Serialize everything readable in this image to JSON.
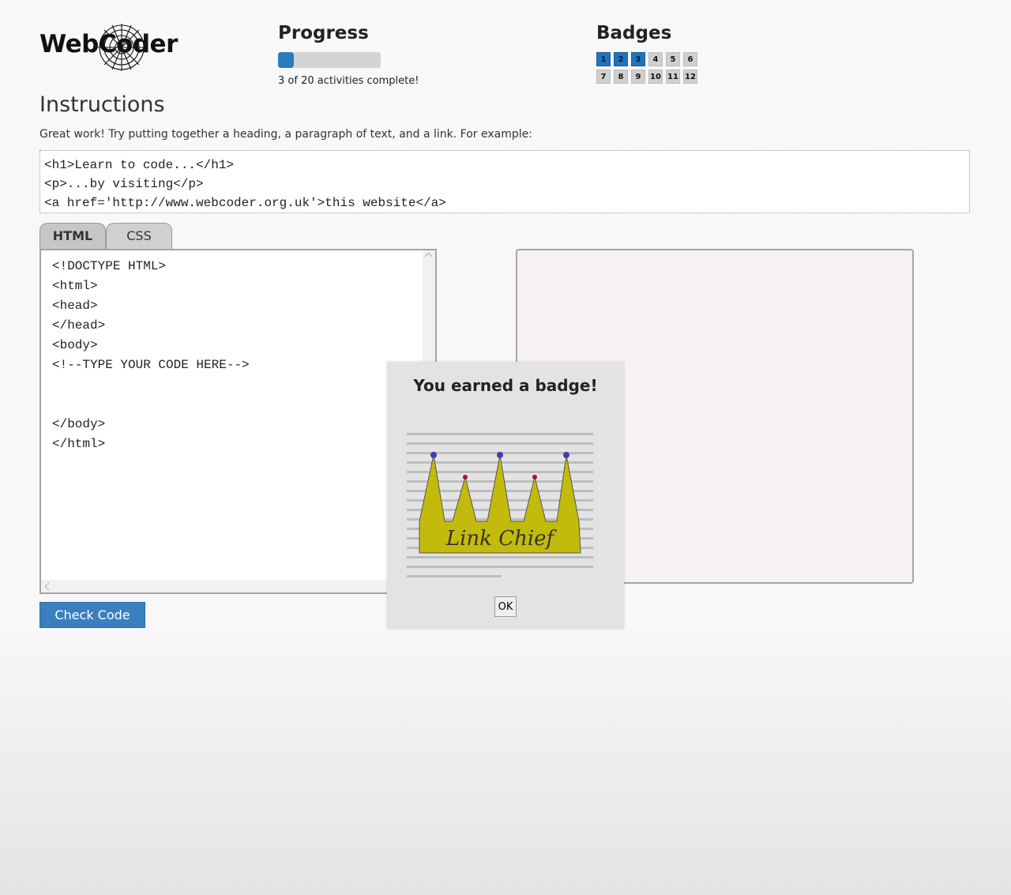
{
  "header": {
    "logo_text": "WebCoder"
  },
  "progress": {
    "title": "Progress",
    "completed": 3,
    "total": 20,
    "fraction": 0.15,
    "status_text": "3 of 20 activities complete!",
    "fill_color": "#2a7bbf"
  },
  "badges": {
    "title": "Badges",
    "items": [
      {
        "label": "1",
        "earned": true
      },
      {
        "label": "2",
        "earned": true
      },
      {
        "label": "3",
        "earned": true
      },
      {
        "label": "4",
        "earned": false
      },
      {
        "label": "5",
        "earned": false
      },
      {
        "label": "6",
        "earned": false
      },
      {
        "label": "7",
        "earned": false
      },
      {
        "label": "8",
        "earned": false
      },
      {
        "label": "9",
        "earned": false
      },
      {
        "label": "10",
        "earned": false
      },
      {
        "label": "11",
        "earned": false
      },
      {
        "label": "12",
        "earned": false
      }
    ],
    "earned_color": "#2173bb"
  },
  "instructions": {
    "title": "Instructions",
    "text": "Great work! Try putting together a heading, a paragraph of text, and a link. For example:",
    "example_code": "<h1>Learn to code...</h1>\n<p>...by visiting</p>\n<a href='http://www.webcoder.org.uk'>this website</a>"
  },
  "tabs": [
    {
      "label": "HTML",
      "active": true
    },
    {
      "label": "CSS",
      "active": false
    }
  ],
  "editor": {
    "code": "<!DOCTYPE HTML>\n<html>\n<head>\n</head>\n<body>\n<!--TYPE YOUR CODE HERE-->\n\n\n</body>\n</html>"
  },
  "check_button": {
    "label": "Check Code",
    "color": "#3a7fc0"
  },
  "modal": {
    "title": "You earned a badge!",
    "badge_text": "Link Chief",
    "ok_label": "OK",
    "crown_color": "#c2bb0b"
  }
}
